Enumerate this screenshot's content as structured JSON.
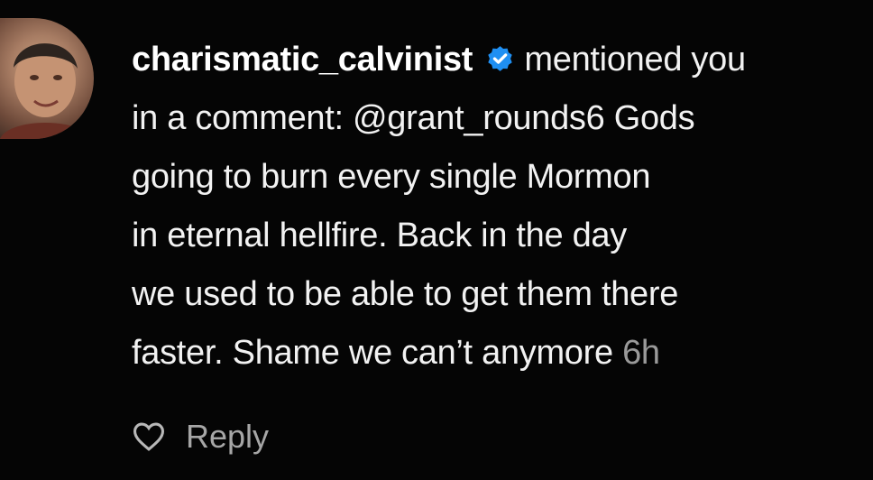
{
  "notification": {
    "username": "charismatic_calvinist",
    "verified": true,
    "lines": [
      "mentioned you",
      "in a comment: @grant_rounds6 Gods",
      "going to burn every single Mormon",
      "in eternal hellfire. Back in the day",
      "we used to be able to get them there",
      "faster. Shame we can’t anymore"
    ],
    "time": "6h",
    "reply_label": "Reply"
  },
  "icons": {
    "verified": "verified-badge-icon",
    "like": "heart-icon"
  },
  "colors": {
    "background": "#050505",
    "text": "#f2f2f2",
    "muted": "#9a9a9a",
    "verified_blue": "#1f8ff2"
  }
}
